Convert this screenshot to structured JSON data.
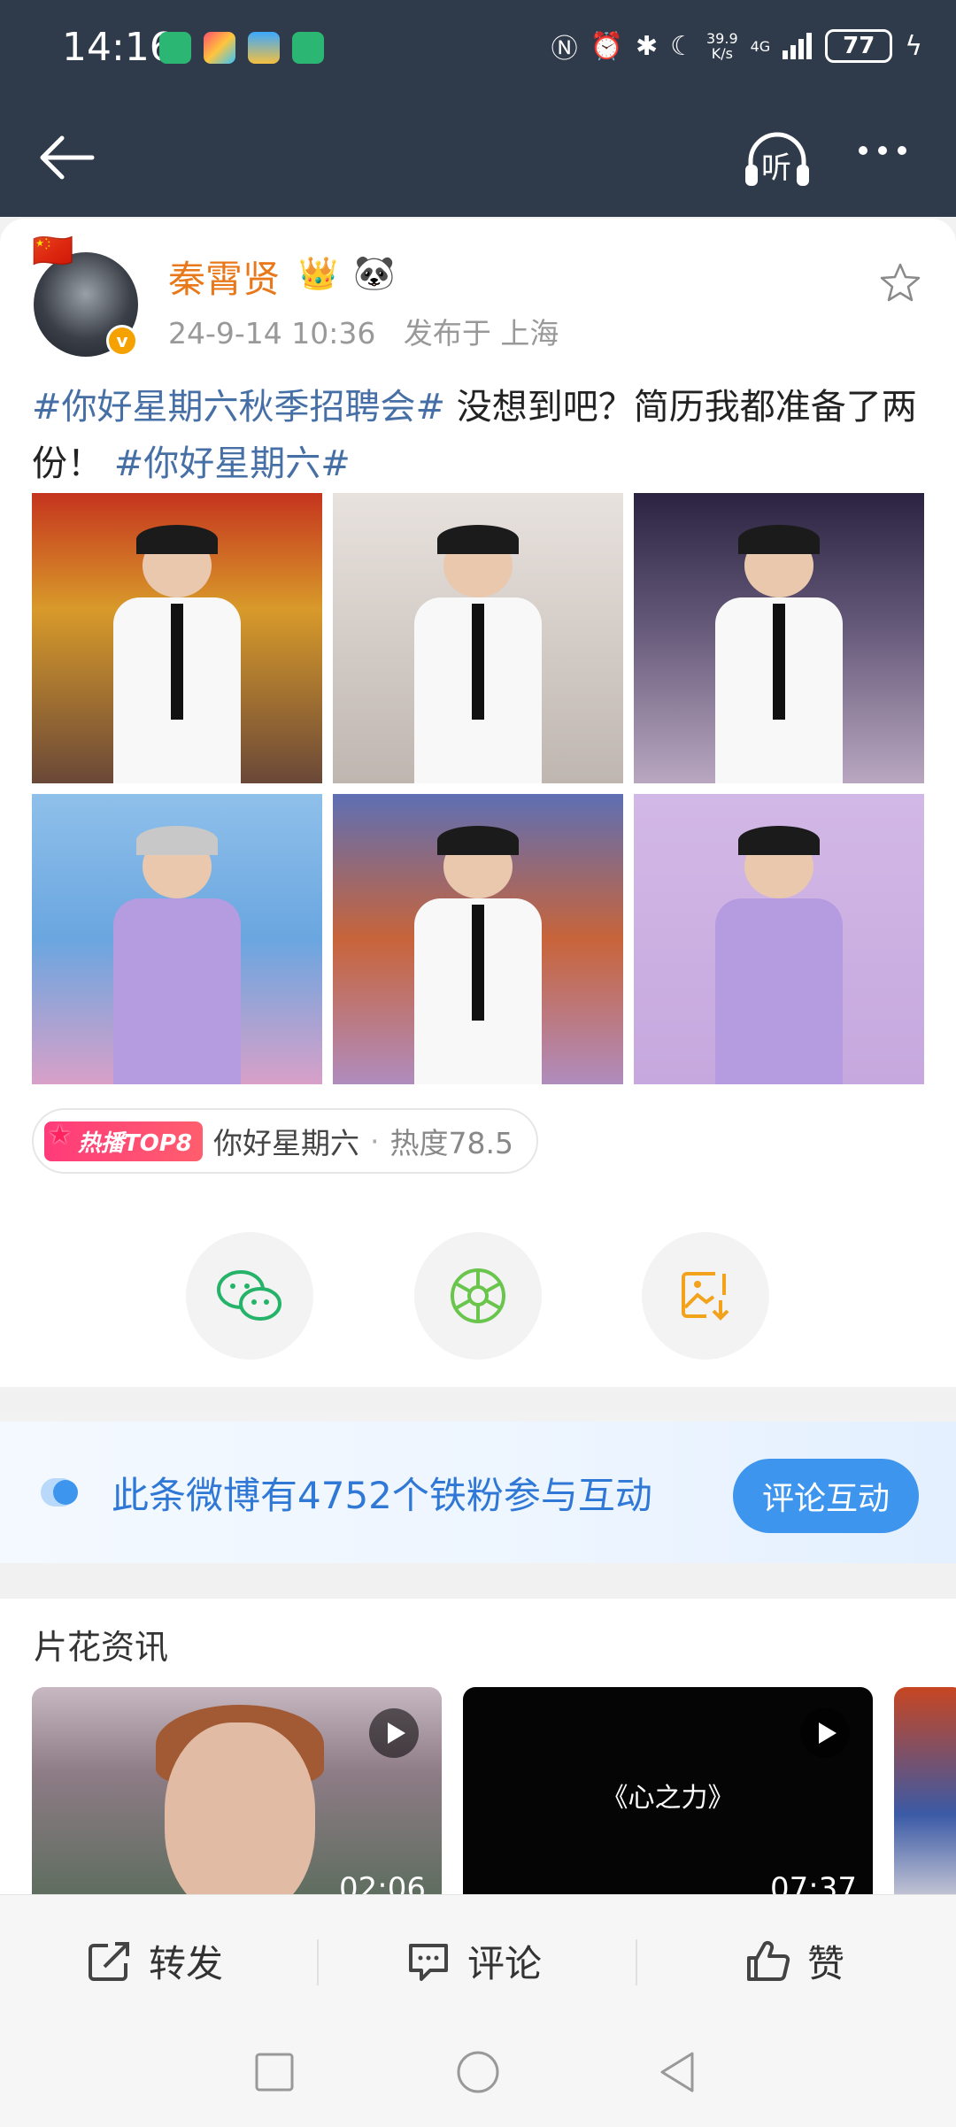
{
  "status": {
    "time": "14:16",
    "net_speed": "39.9",
    "net_unit": "K/s",
    "signal_label": "4G",
    "battery": "77"
  },
  "nav": {
    "listen_label": "听"
  },
  "post": {
    "username": "秦霄贤",
    "timestamp": "24-9-14 10:36",
    "location": "发布于 上海",
    "tag1": "#你好星期六秋季招聘会#",
    "text": " 没想到吧？简历我都准备了两份！",
    "tag2": "#你好星期六#",
    "hot_badge": "热播TOP8",
    "hot_show": "你好星期六",
    "hot_separator": "·",
    "hot_value": "热度78.5"
  },
  "banner": {
    "text": "此条微博有4752个铁粉参与互动",
    "button": "评论互动"
  },
  "clips": {
    "title": "片花资讯",
    "videos": [
      {
        "duration": "02:06",
        "title": ""
      },
      {
        "duration": "07:37",
        "title": "《心之力》"
      }
    ]
  },
  "actions": {
    "repost": "转发",
    "comment": "评论",
    "like": "赞"
  },
  "colors": {
    "header_bg": "#2f3a4a",
    "username": "#e8781a",
    "hashtag": "#466fa6",
    "banner_text": "#2f78d6",
    "banner_button": "#3e95ee"
  }
}
